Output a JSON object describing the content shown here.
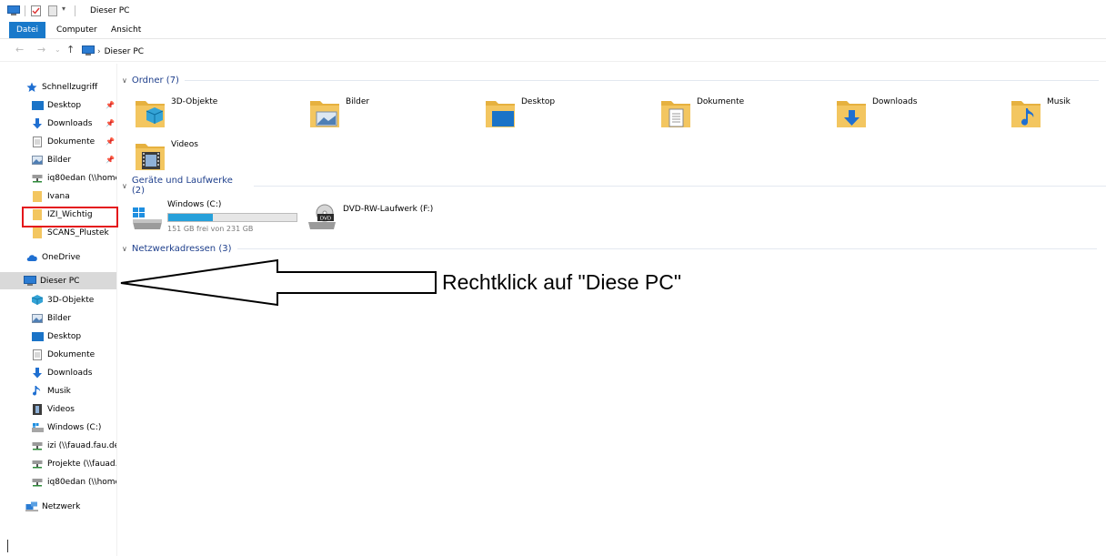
{
  "window": {
    "title": "Dieser PC"
  },
  "ribbon": {
    "tabs": [
      "Datei",
      "Computer",
      "Ansicht"
    ]
  },
  "address": {
    "location": "Dieser PC",
    "separator": "›"
  },
  "nav": {
    "quick_access": "Schnellzugriff",
    "quick_items": [
      "Desktop",
      "Downloads",
      "Dokumente",
      "Bilder",
      "iq80edan (\\\\home.r",
      "Ivana",
      "IZI_Wichtig",
      "SCANS_Plustek"
    ],
    "onedrive": "OneDrive",
    "this_pc": "Dieser PC",
    "pc_items": [
      "3D-Objekte",
      "Bilder",
      "Desktop",
      "Dokumente",
      "Downloads",
      "Musik",
      "Videos",
      "Windows (C:)",
      "izi (\\\\fauad.fau.de\\i",
      "Projekte (\\\\fauad.fa",
      "iq80edan (\\\\home.r"
    ],
    "network": "Netzwerk"
  },
  "content": {
    "folders_header": "Ordner (7)",
    "folders": [
      "3D-Objekte",
      "Bilder",
      "Desktop",
      "Dokumente",
      "Downloads",
      "Musik",
      "Videos"
    ],
    "devices_header": "Geräte und Laufwerke (2)",
    "drive_c": {
      "name": "Windows (C:)",
      "free": "151 GB frei von 231 GB",
      "used_fraction": 0.346
    },
    "dvd": {
      "name": "DVD-RW-Laufwerk (F:)",
      "badge": "DVD"
    },
    "network_header": "Netzwerkadressen (3)"
  },
  "annotation": {
    "text": "Rechtklick auf \"Diese PC\""
  },
  "colors": {
    "accent": "#1979ca",
    "highlight_box": "#e4161b",
    "group_header": "#1e3f8c",
    "drive_bar": "#26a0da",
    "folder": "#f3c660"
  }
}
